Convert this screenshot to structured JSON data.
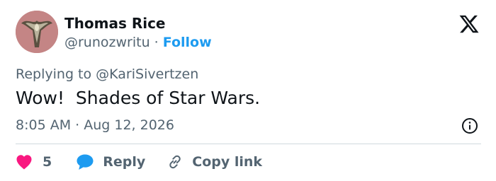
{
  "author": {
    "name": "Thomas Rice",
    "handle": "@runozwritu",
    "separator": " · ",
    "follow_label": "Follow"
  },
  "reply_context": {
    "prefix": "Replying to ",
    "mention": "@KariSivertzen"
  },
  "tweet": {
    "text": "Wow!  Shades of Star Wars.",
    "time": "8:05 AM",
    "separator": " · ",
    "date": "Aug 12, 2026"
  },
  "actions": {
    "like_count": "5",
    "reply_label": "Reply",
    "copy_label": "Copy link"
  },
  "icons": {
    "brand": "x-logo-icon",
    "info": "info-icon",
    "like": "heart-icon",
    "reply": "speech-bubble-icon",
    "copy": "link-icon"
  },
  "colors": {
    "text": "#0f1419",
    "secondary": "#536471",
    "accent": "#1d9bf0",
    "like": "#f91880",
    "divider": "#cfd9de"
  }
}
